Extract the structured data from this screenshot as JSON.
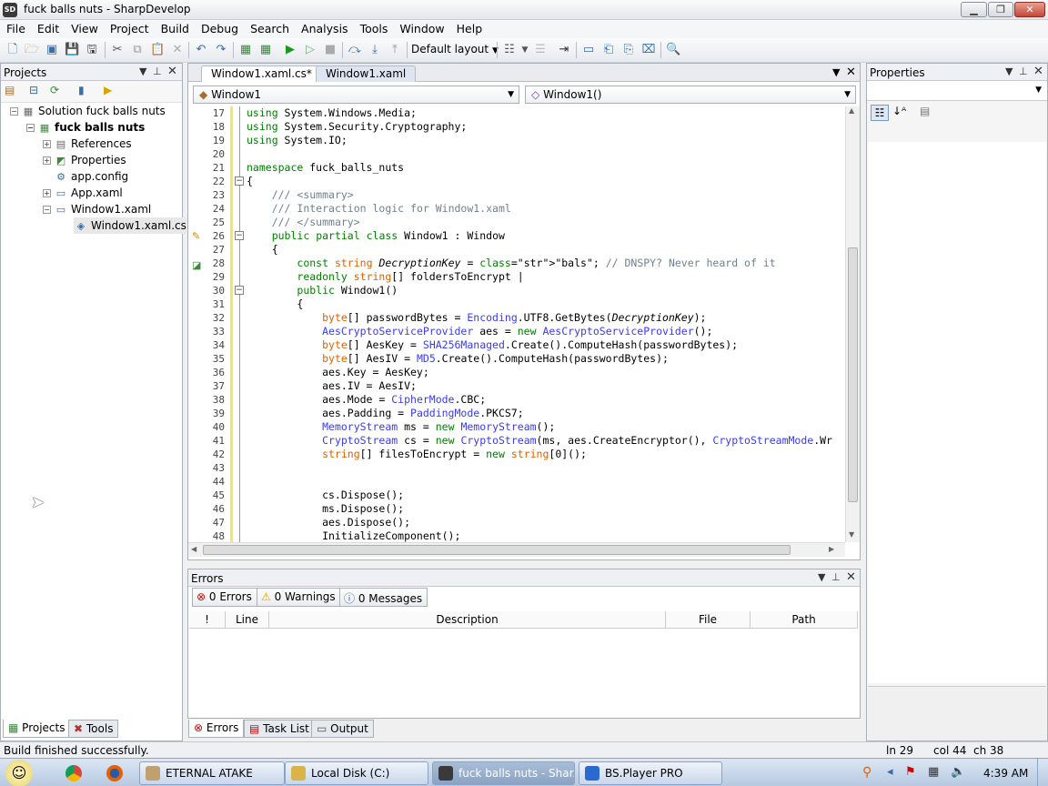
{
  "window": {
    "title": "fuck balls nuts - SharpDevelop",
    "app_icon": "SD"
  },
  "menu": [
    "File",
    "Edit",
    "View",
    "Project",
    "Build",
    "Debug",
    "Search",
    "Analysis",
    "Tools",
    "Window",
    "Help"
  ],
  "toolbar": {
    "layout_label": "Default layout"
  },
  "projects_panel": {
    "title": "Projects",
    "tree": [
      {
        "label": "Solution fuck balls nuts",
        "icon": "solution-icon"
      },
      {
        "label": "fuck balls nuts",
        "icon": "project-icon"
      },
      {
        "label": "References",
        "icon": "references-icon"
      },
      {
        "label": "Properties",
        "icon": "properties-icon"
      },
      {
        "label": "app.config",
        "icon": "config-icon"
      },
      {
        "label": "App.xaml",
        "icon": "xaml-icon"
      },
      {
        "label": "Window1.xaml",
        "icon": "xaml-icon"
      },
      {
        "label": "Window1.xaml.cs",
        "icon": "cs-file-icon"
      }
    ],
    "tabs": [
      "Projects",
      "Tools"
    ]
  },
  "editor": {
    "tabs": [
      "Window1.xaml.cs*",
      "Window1.xaml"
    ],
    "class_combo": "Window1",
    "member_combo": "Window1()",
    "lines": [
      {
        "n": "17",
        "t": "using System.Windows.Media;"
      },
      {
        "n": "18",
        "t": "using System.Security.Cryptography;"
      },
      {
        "n": "19",
        "t": "using System.IO;"
      },
      {
        "n": "20",
        "t": ""
      },
      {
        "n": "21",
        "t": "namespace fuck_balls_nuts"
      },
      {
        "n": "22",
        "t": "{"
      },
      {
        "n": "23",
        "t": "    /// <summary>"
      },
      {
        "n": "24",
        "t": "    /// Interaction logic for Window1.xaml"
      },
      {
        "n": "25",
        "t": "    /// </summary>"
      },
      {
        "n": "26",
        "t": "    public partial class Window1 : Window"
      },
      {
        "n": "27",
        "t": "    {"
      },
      {
        "n": "28",
        "t": "        const string DecryptionKey = \"bals\"; // DNSPY? Never heard of it"
      },
      {
        "n": "29",
        "t": "        readonly string[] foldersToEncrypt |"
      },
      {
        "n": "30",
        "t": "        public Window1()"
      },
      {
        "n": "31",
        "t": "        {"
      },
      {
        "n": "32",
        "t": "            byte[] passwordBytes = Encoding.UTF8.GetBytes(DecryptionKey);"
      },
      {
        "n": "33",
        "t": "            AesCryptoServiceProvider aes = new AesCryptoServiceProvider();"
      },
      {
        "n": "34",
        "t": "            byte[] AesKey = SHA256Managed.Create().ComputeHash(passwordBytes);"
      },
      {
        "n": "35",
        "t": "            byte[] AesIV = MD5.Create().ComputeHash(passwordBytes);"
      },
      {
        "n": "36",
        "t": "            aes.Key = AesKey;"
      },
      {
        "n": "37",
        "t": "            aes.IV = AesIV;"
      },
      {
        "n": "38",
        "t": "            aes.Mode = CipherMode.CBC;"
      },
      {
        "n": "39",
        "t": "            aes.Padding = PaddingMode.PKCS7;"
      },
      {
        "n": "40",
        "t": "            MemoryStream ms = new MemoryStream();"
      },
      {
        "n": "41",
        "t": "            CryptoStream cs = new CryptoStream(ms, aes.CreateEncryptor(), CryptoStreamMode.Wr"
      },
      {
        "n": "42",
        "t": "            string[] filesToEncrypt = new string[0]();"
      },
      {
        "n": "43",
        "t": ""
      },
      {
        "n": "44",
        "t": ""
      },
      {
        "n": "45",
        "t": "            cs.Dispose();"
      },
      {
        "n": "46",
        "t": "            ms.Dispose();"
      },
      {
        "n": "47",
        "t": "            aes.Dispose();"
      },
      {
        "n": "48",
        "t": "            InitializeComponent();"
      }
    ]
  },
  "properties_panel": {
    "title": "Properties"
  },
  "errors_panel": {
    "title": "Errors",
    "errors_btn": "0 Errors",
    "warnings_btn": "0 Warnings",
    "messages_btn": "0 Messages",
    "columns": [
      "!",
      "Line",
      "Description",
      "File",
      "Path"
    ]
  },
  "bottom_tabs": [
    "Errors",
    "Task List",
    "Output"
  ],
  "status": {
    "message": "Build finished successfully.",
    "line": "ln 29",
    "col": "col 44",
    "ch": "ch 38"
  },
  "taskbar": {
    "items": [
      "ETERNAL ATAKE",
      "Local Disk (C:)",
      "fuck balls nuts - Shar...",
      "BS.Player PRO"
    ],
    "clock": "4:39 AM"
  }
}
